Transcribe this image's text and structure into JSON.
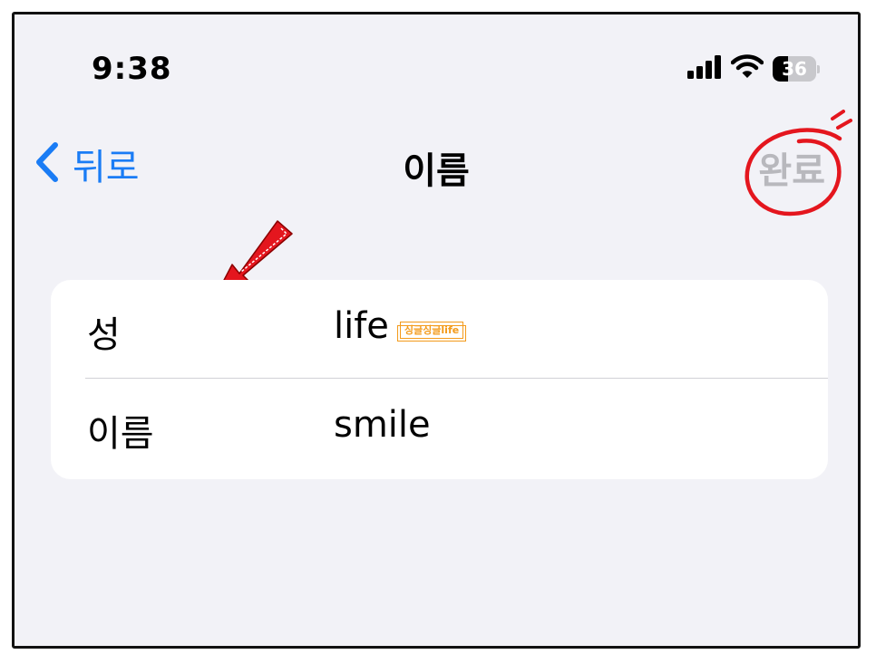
{
  "status_bar": {
    "time": "9:38",
    "battery_level": "36",
    "battery_fraction": 0.36,
    "icons": [
      "cellular-signal-icon",
      "wifi-icon",
      "battery-icon"
    ]
  },
  "nav": {
    "back_label": "뒤로",
    "title": "이름",
    "done_label": "완료"
  },
  "form": {
    "rows": [
      {
        "label": "성",
        "value": "life",
        "watermark": "싱글싱글life"
      },
      {
        "label": "이름",
        "value": "smile"
      }
    ]
  },
  "colors": {
    "accent": "#1a7cf5",
    "disabled": "#b8b8bd",
    "annotation": "#e4161e",
    "watermark": "#f39a1a",
    "background": "#f2f2f7"
  }
}
